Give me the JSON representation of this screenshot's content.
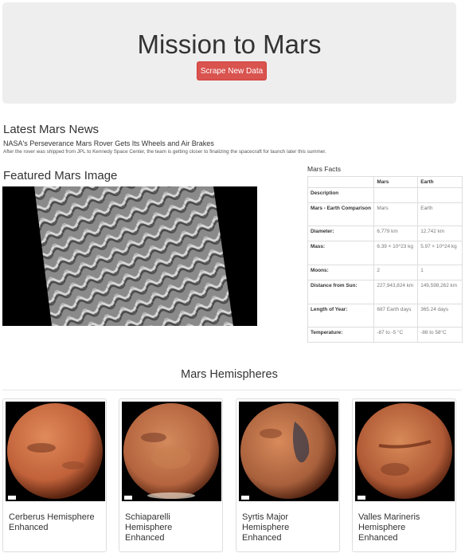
{
  "header": {
    "title": "Mission to Mars",
    "scrape_button": "Scrape New Data"
  },
  "news": {
    "heading": "Latest Mars News",
    "title": "NASA's Perseverance Mars Rover Gets Its Wheels and Air Brakes",
    "paragraph": "After the rover was shipped from JPL to Kennedy Space Center, the team is getting closer to finalizing the spacecraft for launch later this summer."
  },
  "featured": {
    "heading": "Featured Mars Image"
  },
  "facts": {
    "heading": "Mars Facts",
    "columns": [
      "",
      "Mars",
      "Earth"
    ],
    "rows": [
      {
        "label": "Description",
        "mars": "",
        "earth": ""
      },
      {
        "label": "Mars - Earth Comparison",
        "mars": "Mars",
        "earth": "Earth"
      },
      {
        "label": "Diameter:",
        "mars": "6,779 km",
        "earth": "12,742 km"
      },
      {
        "label": "Mass:",
        "mars": "6.39 × 10^23 kg",
        "earth": "5.97 × 10^24 kg"
      },
      {
        "label": "Moons:",
        "mars": "2",
        "earth": "1"
      },
      {
        "label": "Distance from Sun:",
        "mars": "227,943,824 km",
        "earth": "149,598,262 km"
      },
      {
        "label": "Length of Year:",
        "mars": "687 Earth days",
        "earth": "365.24 days"
      },
      {
        "label": "Temperature:",
        "mars": "-87 to -5 °C",
        "earth": "-88 to 58°C"
      }
    ]
  },
  "hemispheres": {
    "heading": "Mars Hemispheres",
    "items": [
      {
        "title": "Cerberus Hemisphere Enhanced",
        "color": "#c0613a"
      },
      {
        "title": "Schiaparelli Hemisphere Enhanced",
        "color": "#b4643e"
      },
      {
        "title": "Syrtis Major Hemisphere Enhanced",
        "color": "#a8603c"
      },
      {
        "title": "Valles Marineris Hemisphere Enhanced",
        "color": "#b05a36"
      }
    ]
  }
}
